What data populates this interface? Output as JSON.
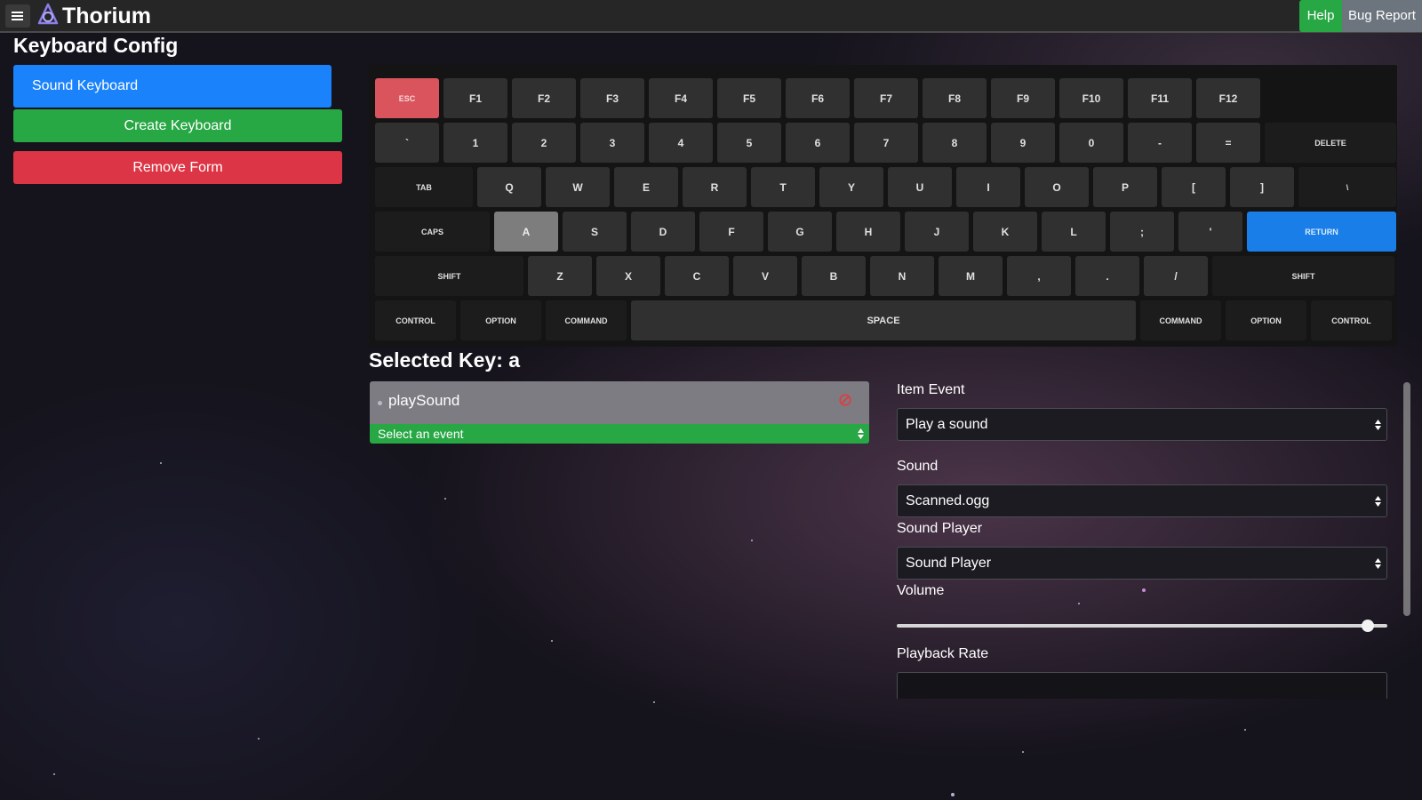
{
  "app": {
    "brand": "Thorium",
    "help_label": "Help",
    "bug_report_label": "Bug Report"
  },
  "page": {
    "title": "Keyboard Config"
  },
  "sidebar": {
    "items": [
      {
        "label": "Sound Keyboard"
      },
      {
        "label": "Create Keyboard"
      },
      {
        "label": "Remove Form"
      }
    ]
  },
  "keyboard": {
    "rows": [
      [
        "ESC",
        "F1",
        "F2",
        "F3",
        "F4",
        "F5",
        "F6",
        "F7",
        "F8",
        "F9",
        "F10",
        "F11",
        "F12"
      ],
      [
        "`",
        "1",
        "2",
        "3",
        "4",
        "5",
        "6",
        "7",
        "8",
        "9",
        "0",
        "-",
        "=",
        "DELETE"
      ],
      [
        "TAB",
        "Q",
        "W",
        "E",
        "R",
        "T",
        "Y",
        "U",
        "I",
        "O",
        "P",
        "[",
        "]",
        "\\"
      ],
      [
        "CAPS",
        "A",
        "S",
        "D",
        "F",
        "G",
        "H",
        "J",
        "K",
        "L",
        ";",
        "'",
        "RETURN"
      ],
      [
        "SHIFT",
        "Z",
        "X",
        "C",
        "V",
        "B",
        "N",
        "M",
        ",",
        ".",
        "/",
        "SHIFT"
      ],
      [
        "CONTROL",
        "OPTION",
        "COMMAND",
        "SPACE",
        "COMMAND",
        "OPTION",
        "CONTROL"
      ]
    ],
    "selected": "A",
    "colors": {
      "esc": "#d9545d",
      "return": "#1a7ee8",
      "selected": "#7d7d7d"
    }
  },
  "selected_key": {
    "label": "Selected Key: a"
  },
  "actions": {
    "items": [
      {
        "label": "playSound"
      }
    ],
    "event_select": {
      "value": "Select an event"
    }
  },
  "config": {
    "item_event": {
      "label": "Item Event",
      "value": "Play a sound"
    },
    "sound": {
      "label": "Sound",
      "value": "Scanned.ogg"
    },
    "sound_player": {
      "label": "Sound Player",
      "value": "Sound Player"
    },
    "volume": {
      "label": "Volume",
      "value_fraction": 0.96
    },
    "playback_rate": {
      "label": "Playback Rate",
      "value": ""
    }
  }
}
